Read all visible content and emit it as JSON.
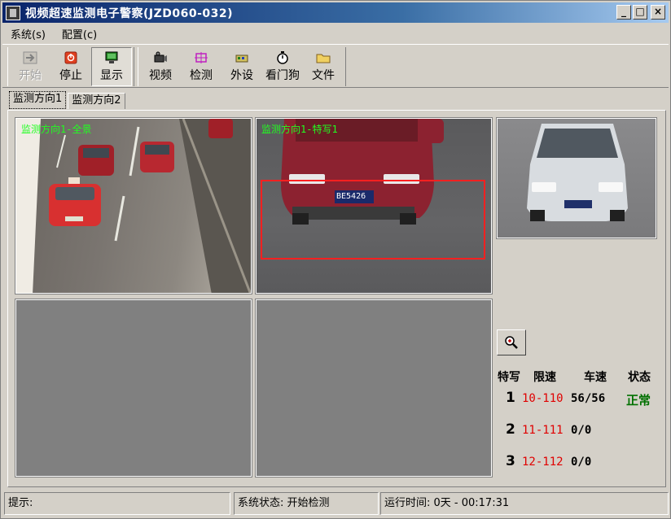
{
  "window": {
    "title": "视频超速监测电子警察(JZD060-032)"
  },
  "menu": {
    "items": [
      "系统(s)",
      "配置(c)"
    ]
  },
  "toolbar": {
    "group1": [
      {
        "label": "开始",
        "icon": "arrow-right-icon"
      },
      {
        "label": "停止",
        "icon": "stop-icon"
      },
      {
        "label": "显示",
        "icon": "monitor-icon"
      }
    ],
    "group2": [
      {
        "label": "视频",
        "icon": "camera-icon"
      },
      {
        "label": "检测",
        "icon": "detect-grid-icon"
      },
      {
        "label": "外设",
        "icon": "peripheral-icon"
      },
      {
        "label": "看门狗",
        "icon": "stopwatch-icon"
      },
      {
        "label": "文件",
        "icon": "folder-icon"
      }
    ]
  },
  "tabs": [
    "监测方向1",
    "监测方向2"
  ],
  "panes": {
    "overview_caption": "监测方向1-全景",
    "closeup_caption": "监测方向1-特写1",
    "plate": "BE5426"
  },
  "capture": {
    "headers": [
      "特写",
      "限速",
      "车速",
      "状态"
    ],
    "rows": [
      {
        "num": "1",
        "limit": "10-110",
        "speed": "56/56",
        "status": "正常"
      },
      {
        "num": "2",
        "limit": "11-111",
        "speed": "0/0",
        "status": ""
      },
      {
        "num": "3",
        "limit": "12-112",
        "speed": "0/0",
        "status": ""
      }
    ]
  },
  "statusbar": {
    "hint": "提示:",
    "system_status": "系统状态: 开始检测",
    "runtime": "运行时间: 0天 - 00:17:31"
  },
  "colors": {
    "title_start": "#0a246a",
    "caption": "#20ff20",
    "limit": "#e00000",
    "status_ok": "#007000",
    "roi": "#ff2020"
  }
}
